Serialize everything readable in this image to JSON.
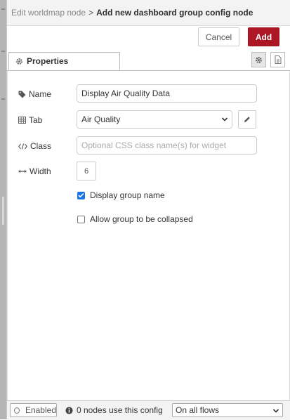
{
  "header": {
    "breadcrumb_prev": "Edit worldmap node",
    "separator": ">",
    "title": "Add new dashboard group config node"
  },
  "buttons": {
    "cancel": "Cancel",
    "add": "Add"
  },
  "tabs": {
    "properties": "Properties",
    "settings_icon": "gear-icon",
    "description_icon": "document-icon"
  },
  "form": {
    "name": {
      "label": "Name",
      "icon": "tag-icon",
      "value": "Display Air Quality Data"
    },
    "tab": {
      "label": "Tab",
      "icon": "table-icon",
      "value": "Air Quality"
    },
    "class": {
      "label": "Class",
      "icon": "code-icon",
      "value": "",
      "placeholder": "Optional CSS class name(s) for widget"
    },
    "width": {
      "label": "Width",
      "icon": "arrows-h-icon",
      "value": "6"
    },
    "display_group_name": {
      "label": "Display group name",
      "checked": true
    },
    "allow_collapse": {
      "label": "Allow group to be collapsed",
      "checked": false
    }
  },
  "footer": {
    "enabled": "Enabled",
    "usage": "0 nodes use this config",
    "scope": "On all flows"
  },
  "colors": {
    "accent": "#ad1625",
    "checkbox": "#1a73e8"
  }
}
